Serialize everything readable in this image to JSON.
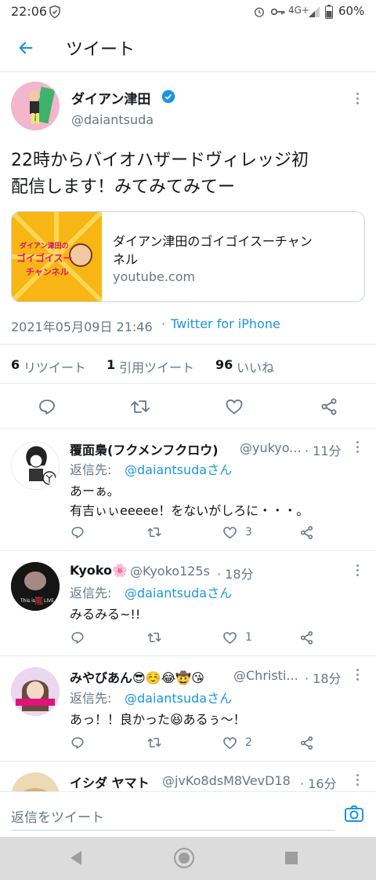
{
  "status_bar": {
    "time": "22:06",
    "network": "4G+",
    "battery": "60%"
  },
  "header": {
    "title": "ツイート"
  },
  "tweet": {
    "display_name": "ダイアン津田",
    "handle": "@daiantsuda",
    "text_line1": "22時からバイオハザードヴィレッジ初",
    "text_line2": "配信します！みてみてみてー",
    "card": {
      "title_line1": "ダイアン津田のゴイゴイスーチャン",
      "title_line2": "ネル",
      "domain": "youtube.com",
      "thumb_line1": "ダイアン津田の",
      "thumb_line2": "ゴイゴイスー",
      "thumb_line3": "チャンネル"
    },
    "timestamp": "2021年05月09日 21:46",
    "separator": "·",
    "source": "Twitter for iPhone",
    "stats": {
      "retweets_count": "6",
      "retweets_label": "リツイート",
      "quotes_count": "1",
      "quotes_label": "引用ツイート",
      "likes_count": "96",
      "likes_label": "いいね"
    }
  },
  "replies": [
    {
      "display_name": "覆面梟(フクメンフクロウ)",
      "handle": "@yukyo...",
      "time": "· 11分",
      "reply_to_prefix": "返信先: ",
      "reply_to_handle": "@daiantsudaさん",
      "text_line1": "あーぁ。",
      "text_line2": "有吉ぃぃeeeee！をないがしろに・・・。",
      "likes": "3"
    },
    {
      "display_name": "Kyoko🌸",
      "handle": "@Kyoko125s",
      "time": "· 18分",
      "reply_to_prefix": "返信先: ",
      "reply_to_handle": "@daiantsudaさん",
      "text_line1": "みるみる~!!",
      "likes": "1"
    },
    {
      "display_name": "みやびあん😎☺️😂🤠😘",
      "handle": "@Christi...",
      "time": "· 18分",
      "reply_to_prefix": "返信先: ",
      "reply_to_handle": "@daiantsudaさん",
      "text_line1": "あっ！！良かった😆あるぅ～！",
      "likes": "2"
    },
    {
      "display_name": "イシダ ヤマト",
      "handle": "@jvKo8dsM8VevD18",
      "time": "· 16分"
    }
  ],
  "reply_bar": {
    "placeholder": "返信をツイート"
  },
  "colors": {
    "accent": "#1b95e0",
    "secondary": "#657786",
    "border": "#e6ecf0"
  }
}
